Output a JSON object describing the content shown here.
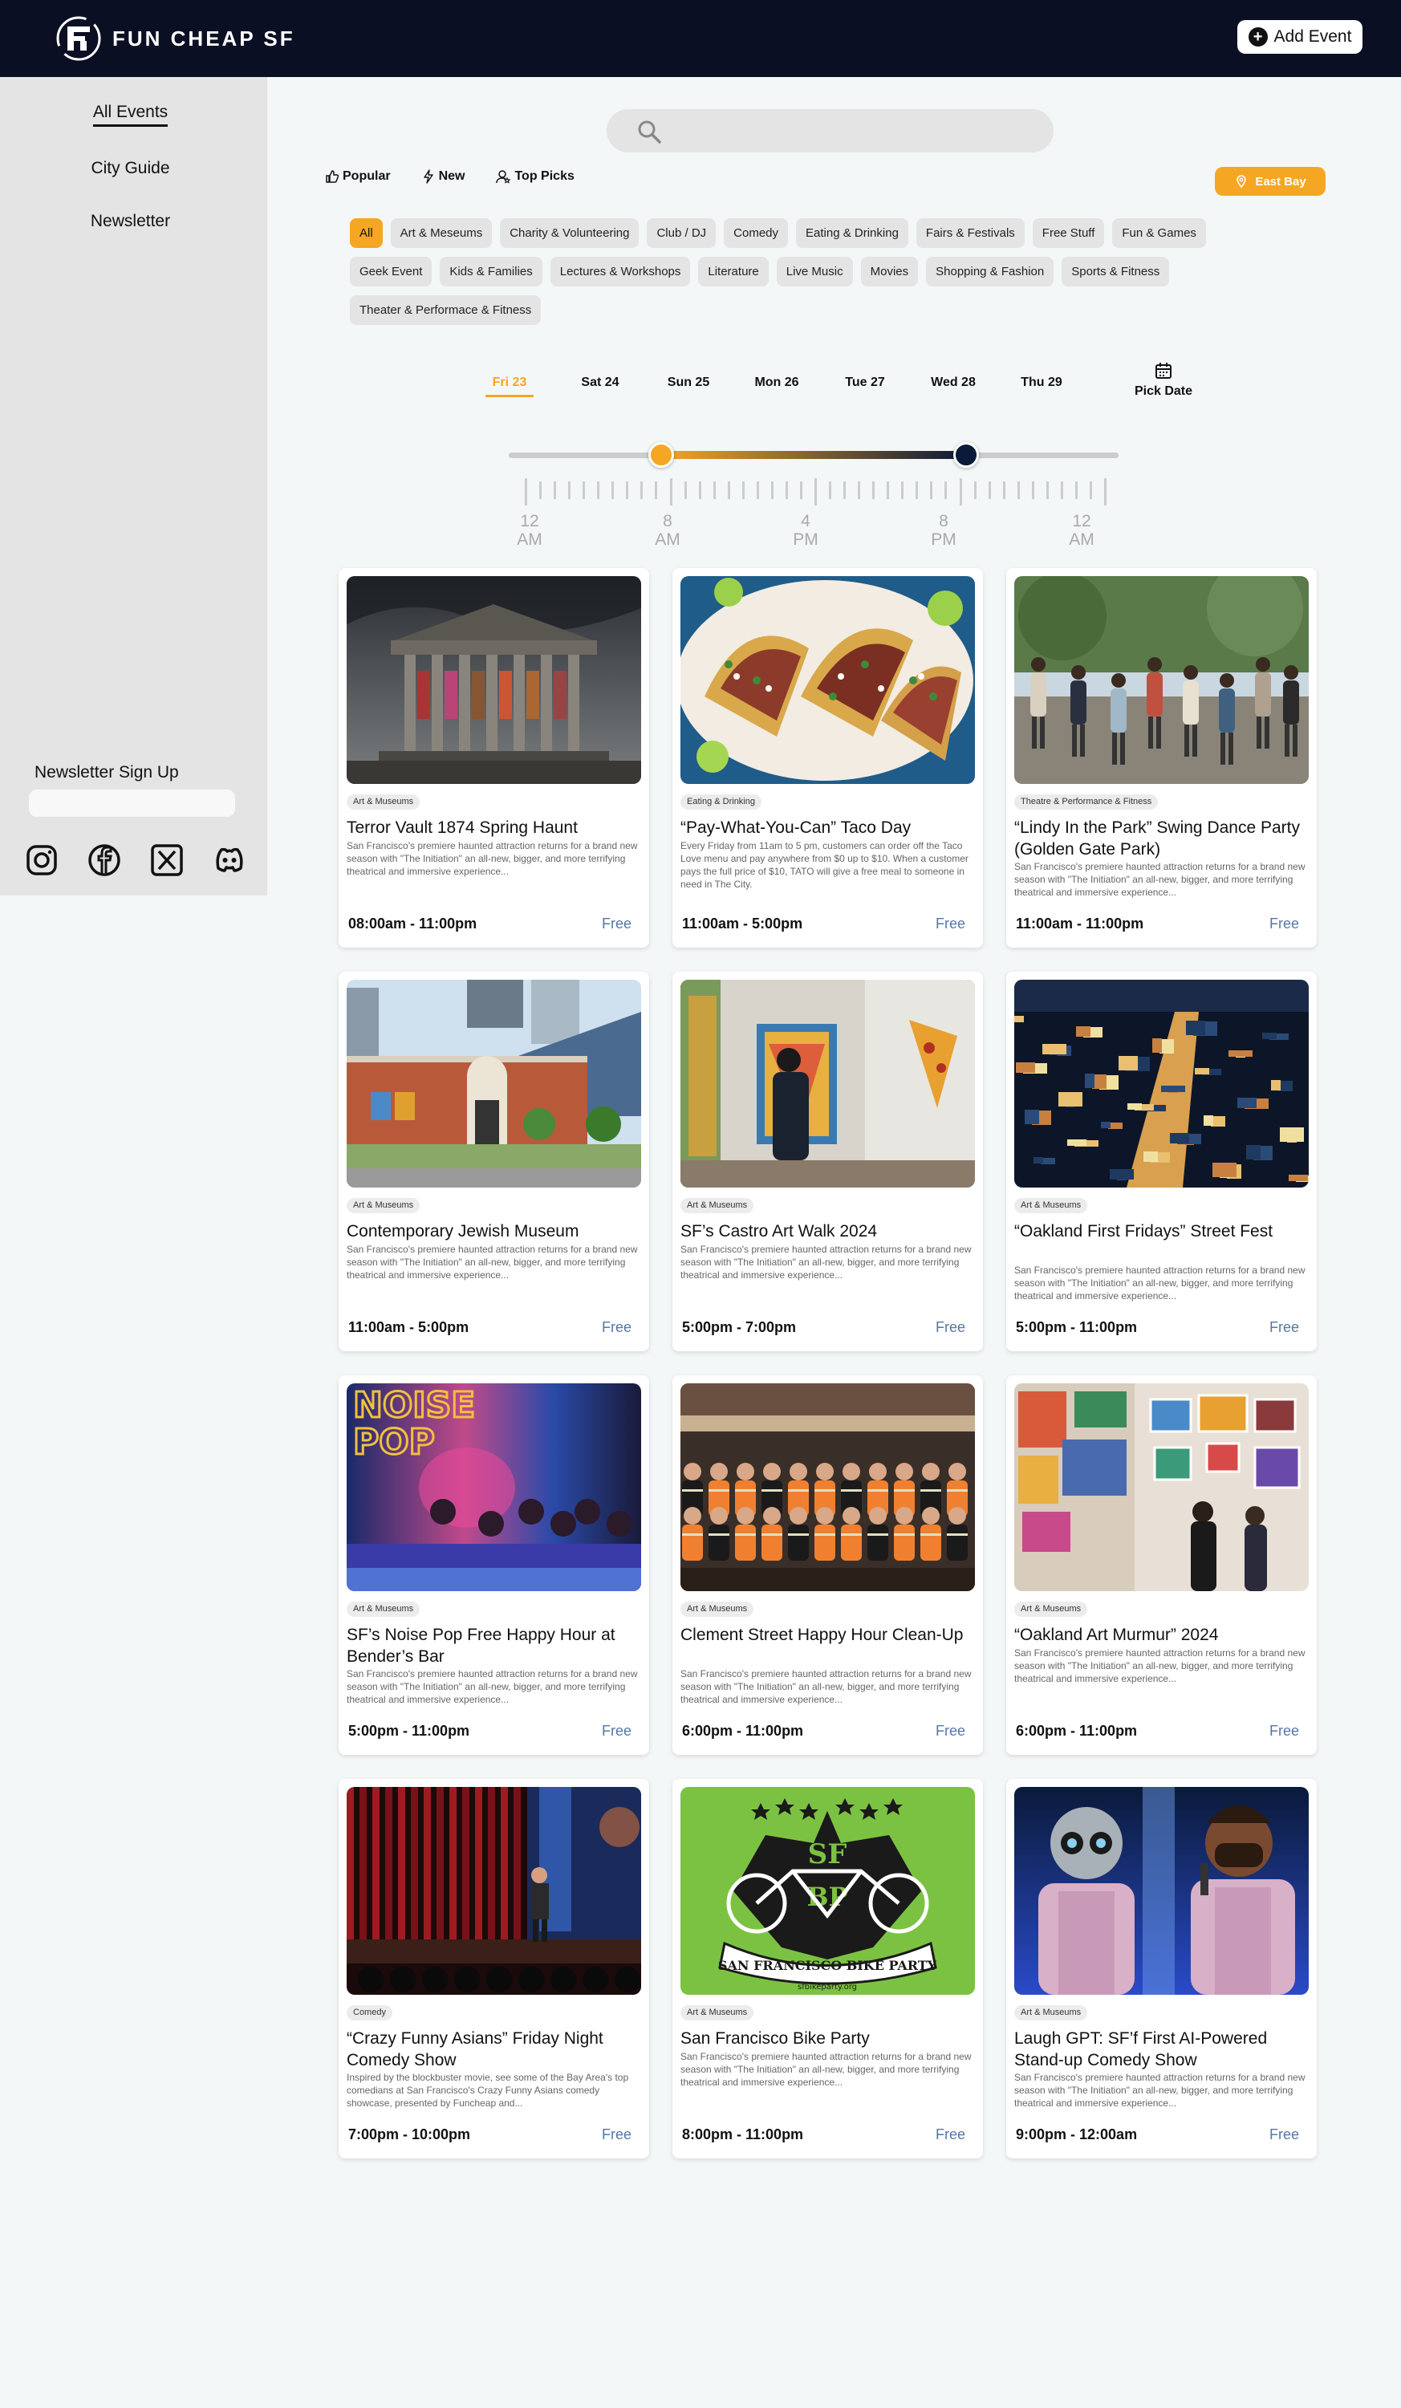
{
  "header": {
    "logo_text": "FUN CHEAP SF",
    "add_event_label": "Add Event"
  },
  "sidebar": {
    "items": [
      {
        "label": "All Events",
        "active": true
      },
      {
        "label": "City Guide",
        "active": false
      },
      {
        "label": "Newsletter",
        "active": false
      }
    ],
    "newsletter_label": "Newsletter Sign Up",
    "newsletter_placeholder": "",
    "socials": [
      "instagram-icon",
      "facebook-icon",
      "x-icon",
      "discord-icon"
    ]
  },
  "filters": {
    "tabs": [
      {
        "label": "Popular",
        "icon": "thumbs-up-icon"
      },
      {
        "label": "New",
        "icon": "bolt-icon"
      },
      {
        "label": "Top Picks",
        "icon": "user-star-icon"
      }
    ],
    "location": "East Bay",
    "categories": [
      "All",
      "Art & Meseums",
      "Charity & Volunteering",
      "Club / DJ",
      "Comedy",
      "Eating & Drinking",
      "Fairs & Festivals",
      "Free Stuff",
      "Fun & Games",
      "Geek Event",
      "Kids & Families",
      "Lectures & Workshops",
      "Literature",
      "Live Music",
      "Movies",
      "Shopping & Fashion",
      "Sports & Fitness",
      "Theater & Performace & Fitness"
    ],
    "active_category": "All"
  },
  "days": {
    "items": [
      "Fri 23",
      "Sat 24",
      "Sun 25",
      "Mon 26",
      "Tue 27",
      "Wed 28",
      "Thu 29"
    ],
    "active": "Fri 23",
    "pick_date_label": "Pick Date"
  },
  "time_range": {
    "labels": [
      [
        "12",
        "AM"
      ],
      [
        "8",
        "AM"
      ],
      [
        "4",
        "PM"
      ],
      [
        "8",
        "PM"
      ],
      [
        "12",
        "AM"
      ]
    ],
    "start_fraction": 0.25,
    "end_fraction": 0.75,
    "colors": {
      "start": "#f5a623",
      "end": "#0b1a38"
    }
  },
  "events": [
    {
      "category": "Art & Museums",
      "title": "Terror Vault 1874 Spring Haunt",
      "description": "San Francisco's premiere haunted attraction returns for a brand new season with \"The Initiation\" an all-new, bigger, and more terrifying theatrical and immersive experience...",
      "time": "08:00am - 11:00pm",
      "price": "Free"
    },
    {
      "category": "Eating & Drinking",
      "title": "“Pay-What-You-Can” Taco Day",
      "description": "Every Friday from 11am to 5 pm, customers can order off the Taco Love menu and pay anywhere from $0 up to $10. When a customer pays the full price of $10, TATO will give a free meal to someone in need in The City.",
      "time": "11:00am - 5:00pm",
      "price": "Free"
    },
    {
      "category": "Theatre & Performance & Fitness",
      "title": "“Lindy In the Park” Swing Dance Party (Golden Gate Park)",
      "description": "San Francisco's premiere haunted attraction returns for a brand new season with \"The Initiation\" an all-new, bigger, and more terrifying theatrical and immersive experience...",
      "time": "11:00am - 11:00pm",
      "price": "Free"
    },
    {
      "category": "Art & Museums",
      "title": "Contemporary Jewish Museum",
      "description": "San Francisco's premiere haunted attraction returns for a brand new season with \"The Initiation\" an all-new, bigger, and more terrifying theatrical and immersive experience...",
      "time": "11:00am - 5:00pm",
      "price": "Free"
    },
    {
      "category": "Art & Museums",
      "title": "SF’s Castro Art Walk 2024",
      "description": "San Francisco's premiere haunted attraction returns for a brand new season with \"The Initiation\" an all-new, bigger, and more terrifying theatrical and immersive experience...",
      "time": "5:00pm - 7:00pm",
      "price": "Free"
    },
    {
      "category": "Art & Museums",
      "title": "“Oakland First Fridays” Street Fest",
      "description": "San Francisco's premiere haunted attraction returns for a brand new season with \"The Initiation\" an all-new, bigger, and more terrifying theatrical and immersive experience...",
      "time": "5:00pm - 11:00pm",
      "price": "Free"
    },
    {
      "category": "Art & Museums",
      "title": "SF’s Noise Pop Free Happy Hour at Bender’s Bar",
      "description": "San Francisco's premiere haunted attraction returns for a brand new season with \"The Initiation\" an all-new, bigger, and more terrifying theatrical and immersive experience...",
      "time": "5:00pm - 11:00pm",
      "price": "Free"
    },
    {
      "category": "Art & Museums",
      "title": "Clement Street Happy Hour Clean-Up",
      "description": "San Francisco's premiere haunted attraction returns for a brand new season with \"The Initiation\" an all-new, bigger, and more terrifying theatrical and immersive experience...",
      "time": "6:00pm - 11:00pm",
      "price": "Free"
    },
    {
      "category": "Art & Museums",
      "title": "“Oakland Art Murmur” 2024",
      "description": "San Francisco's premiere haunted attraction returns for a brand new season with \"The Initiation\" an all-new, bigger, and more terrifying theatrical and immersive experience...",
      "time": "6:00pm - 11:00pm",
      "price": "Free"
    },
    {
      "category": "Comedy",
      "title": "“Crazy Funny Asians” Friday Night Comedy Show",
      "description": "Inspired by the blockbuster movie, see some of the Bay Area's top comedians at San Francisco's Crazy Funny Asians comedy showcase, presented by Funcheap and...",
      "time": "7:00pm - 10:00pm",
      "price": "Free"
    },
    {
      "category": "Art & Museums",
      "title": "San Francisco Bike Party",
      "description": "San Francisco's premiere haunted attraction returns for a brand new season with \"The Initiation\" an all-new, bigger, and more terrifying theatrical and immersive experience...",
      "time": "8:00pm - 11:00pm",
      "price": "Free"
    },
    {
      "category": "Art & Museums",
      "title": "Laugh GPT: SF’f First AI-Powered Stand-up Comedy Show",
      "description": "San Francisco's premiere haunted attraction returns for a brand new season with \"The Initiation\" an all-new, bigger, and more terrifying theatrical and immersive experience...",
      "time": "9:00pm - 12:00am",
      "price": "Free"
    }
  ],
  "image_texts": {
    "noise_pop": [
      "NOISE",
      "POP"
    ],
    "bike_party": [
      "SF",
      "BP",
      "SAN FRANCISCO BIKE PARTY",
      "sfbikeparty.org"
    ]
  }
}
